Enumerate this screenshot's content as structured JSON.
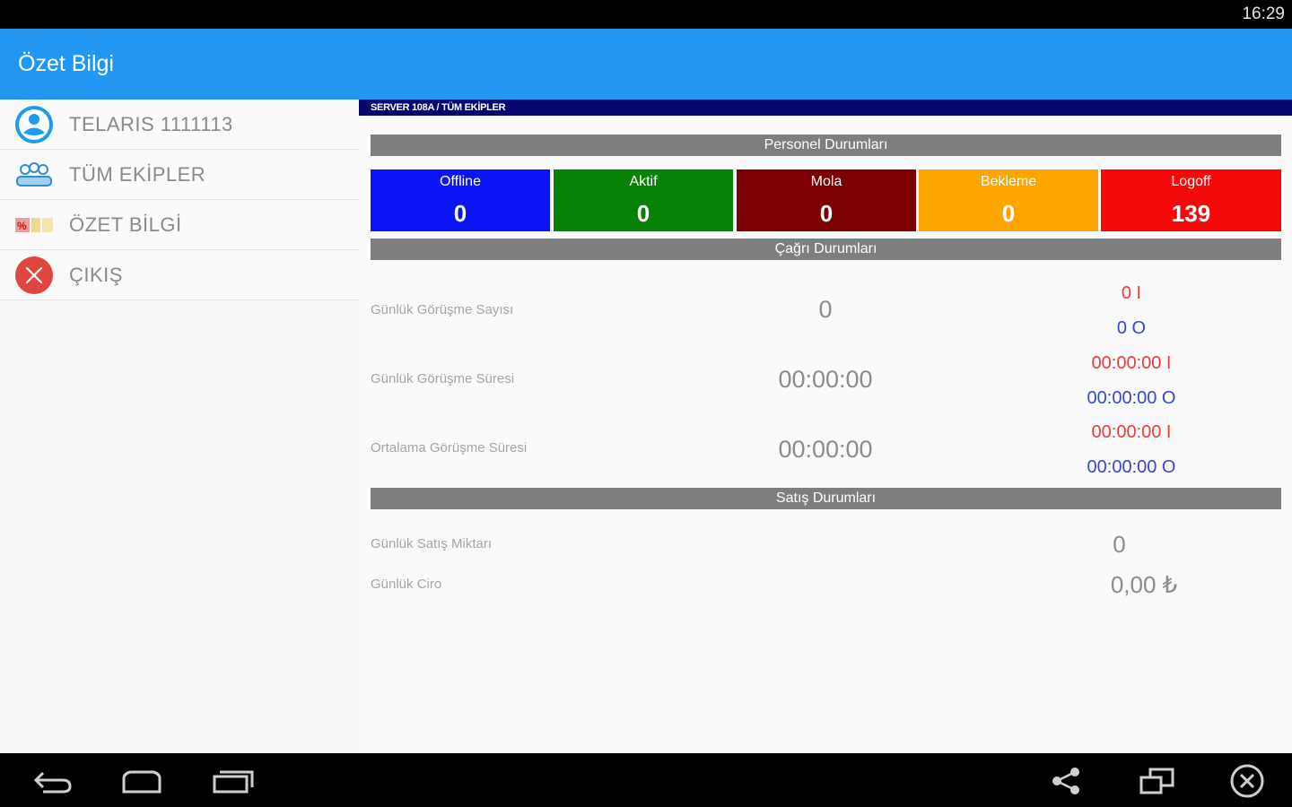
{
  "status": {
    "time": "16:29"
  },
  "app": {
    "title": "Özet Bilgi"
  },
  "sidebar": {
    "items": [
      {
        "label": "TELARIS 1111113",
        "icon": "user-icon"
      },
      {
        "label": "TÜM EKİPLER",
        "icon": "team-icon"
      },
      {
        "label": "ÖZET BİLGİ",
        "icon": "summary-icon"
      },
      {
        "label": "ÇIKIŞ",
        "icon": "close-icon"
      }
    ]
  },
  "content": {
    "server_label": "SERVER 108A / TÜM EKİPLER",
    "personnel": {
      "header": "Personel Durumları",
      "stats": [
        {
          "label": "Offline",
          "value": "0",
          "color": "#0a14f5"
        },
        {
          "label": "Aktif",
          "value": "0",
          "color": "#078207"
        },
        {
          "label": "Mola",
          "value": "0",
          "color": "#7d0000"
        },
        {
          "label": "Bekleme",
          "value": "0",
          "color": "#ffa500"
        },
        {
          "label": "Logoff",
          "value": "139",
          "color": "#f50a0a"
        }
      ]
    },
    "calls": {
      "header": "Çağrı Durumları",
      "rows": [
        {
          "label": "Günlük Görüşme Sayısı",
          "value": "0",
          "in": "0 I",
          "out": "0 O"
        },
        {
          "label": "Günlük Görüşme Süresi",
          "value": "00:00:00",
          "in": "00:00:00 I",
          "out": "00:00:00 O"
        },
        {
          "label": "Ortalama Görüşme Süresi",
          "value": "00:00:00",
          "in": "00:00:00 I",
          "out": "00:00:00 O"
        }
      ]
    },
    "sales": {
      "header": "Satış Durumları",
      "rows": [
        {
          "label": "Günlük Satış Miktarı",
          "value": "0"
        },
        {
          "label": "Günlük Ciro",
          "value": "0,00 ₺"
        }
      ]
    }
  },
  "navbar": {
    "buttons": [
      "back-icon",
      "home-icon",
      "recent-apps-icon",
      "share-icon",
      "window-icon",
      "close-circle-icon"
    ]
  }
}
